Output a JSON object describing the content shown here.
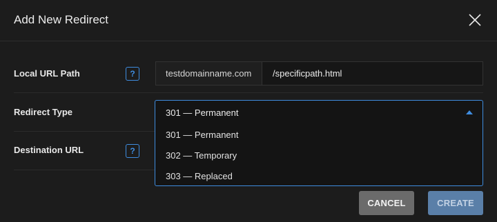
{
  "dialog": {
    "title": "Add New Redirect"
  },
  "fields": {
    "local_url_path": {
      "label": "Local URL Path",
      "help_glyph": "?",
      "domain": "testdomainname.com",
      "path_value": "/specificpath.html"
    },
    "redirect_type": {
      "label": "Redirect Type",
      "selected": "301 — Permanent",
      "options": [
        "301 — Permanent",
        "302 — Temporary",
        "303 — Replaced"
      ]
    },
    "destination_url": {
      "label": "Destination URL",
      "help_glyph": "?"
    }
  },
  "buttons": {
    "cancel": "CANCEL",
    "create": "CREATE"
  },
  "colors": {
    "accent": "#3f8de0",
    "background": "#1c1c1c",
    "cancel_bg": "#6b6b6b",
    "create_bg": "#5a7fa8"
  }
}
